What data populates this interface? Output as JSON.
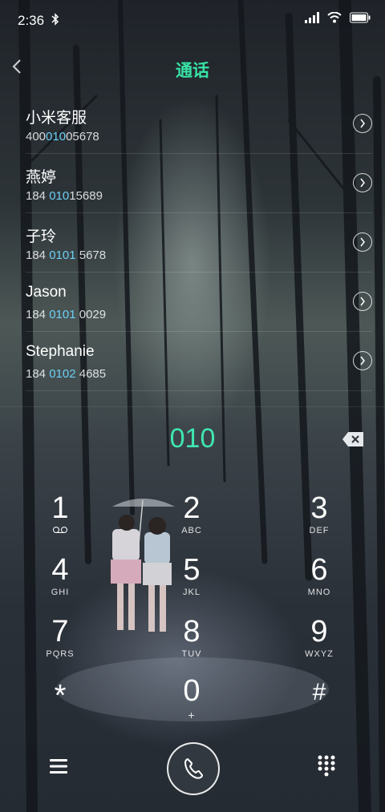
{
  "status": {
    "time": "2:36",
    "battery_icon": "battery-icon",
    "wifi_icon": "wifi-icon",
    "signal_icon": "signal-icon",
    "bluetooth_icon": "bluetooth-icon"
  },
  "header": {
    "title": "通话",
    "back_icon": "chevron-left-icon"
  },
  "contacts": [
    {
      "name": "小米客服",
      "num_pre": "400",
      "num_hl": "010",
      "num_post": "05678"
    },
    {
      "name": "燕婷",
      "num_pre": "184 ",
      "num_hl": "010",
      "num_post": "15689"
    },
    {
      "name": "子玲",
      "num_pre": "184 ",
      "num_hl": "0101",
      "num_post": " 5678"
    },
    {
      "name": "Jason",
      "num_pre": "184 ",
      "num_hl": "0101",
      "num_post": " 0029"
    },
    {
      "name": "Stephanie",
      "num_pre": "184 ",
      "num_hl": "0102",
      "num_post": " 4685"
    }
  ],
  "dialer": {
    "input": "010",
    "keys": [
      {
        "digit": "1",
        "letters": ""
      },
      {
        "digit": "2",
        "letters": "ABC"
      },
      {
        "digit": "3",
        "letters": "DEF"
      },
      {
        "digit": "4",
        "letters": "GHI"
      },
      {
        "digit": "5",
        "letters": "JKL"
      },
      {
        "digit": "6",
        "letters": "MNO"
      },
      {
        "digit": "7",
        "letters": "PQRS"
      },
      {
        "digit": "8",
        "letters": "TUV"
      },
      {
        "digit": "9",
        "letters": "WXYZ"
      },
      {
        "digit": "*",
        "letters": ""
      },
      {
        "digit": "0",
        "letters": "+"
      },
      {
        "digit": "#",
        "letters": ""
      }
    ]
  },
  "colors": {
    "accent": "#37e3a6",
    "highlight": "#6ccff5"
  }
}
